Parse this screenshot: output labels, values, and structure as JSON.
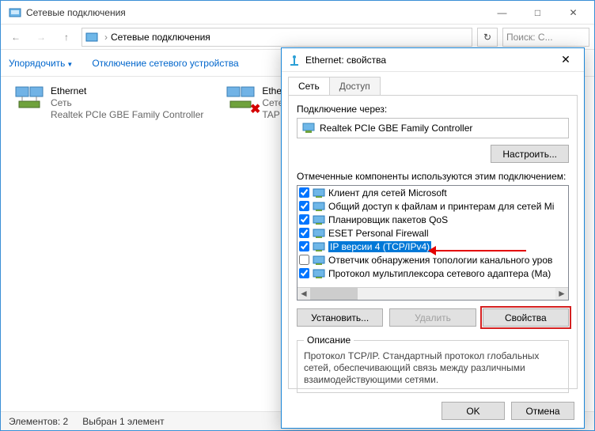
{
  "window": {
    "title": "Сетевые подключения",
    "min": "—",
    "max": "□",
    "close": "✕"
  },
  "nav": {
    "back": "←",
    "fwd": "→",
    "up": "↑",
    "breadcrumb": "Сетевые подключения",
    "bc_sep": "›",
    "refresh": "↻",
    "search_placeholder": "Поиск: С..."
  },
  "toolbar": {
    "organize": "Упорядочить",
    "disable": "Отключение сетевого устройства"
  },
  "adapters": [
    {
      "name": "Ethernet",
      "status": "Сеть",
      "device": "Realtek PCIe GBE Family Controller",
      "error": false
    },
    {
      "name": "Ethe",
      "status": "Сете",
      "device": "TAP",
      "error": true
    }
  ],
  "statusbar": {
    "elements": "Элементов: 2",
    "selected": "Выбран 1 элемент"
  },
  "dialog": {
    "title": "Ethernet: свойства",
    "close": "✕",
    "tabs": {
      "net": "Сеть",
      "access": "Доступ"
    },
    "connect_label": "Подключение через:",
    "adapter": "Realtek PCIe GBE Family Controller",
    "configure": "Настроить...",
    "components_label": "Отмеченные компоненты используются этим подключением:",
    "components": [
      {
        "checked": true,
        "label": "Клиент для сетей Microsoft"
      },
      {
        "checked": true,
        "label": "Общий доступ к файлам и принтерам для сетей Mi"
      },
      {
        "checked": true,
        "label": "Планировщик пакетов QoS"
      },
      {
        "checked": true,
        "label": "ESET Personal Firewall"
      },
      {
        "checked": true,
        "label": "IP версии 4 (TCP/IPv4)",
        "selected": true
      },
      {
        "checked": false,
        "label": "Ответчик обнаружения топологии канального уров"
      },
      {
        "checked": true,
        "label": "Протокол мультиплексора сетевого адаптера (Ма)"
      }
    ],
    "install": "Установить...",
    "remove": "Удалить",
    "properties": "Свойства",
    "desc_title": "Описание",
    "desc_text": "Протокол TCP/IP. Стандартный протокол глобальных сетей, обеспечивающий связь между различными взаимодействующими сетями.",
    "ok": "OK",
    "cancel": "Отмена"
  }
}
